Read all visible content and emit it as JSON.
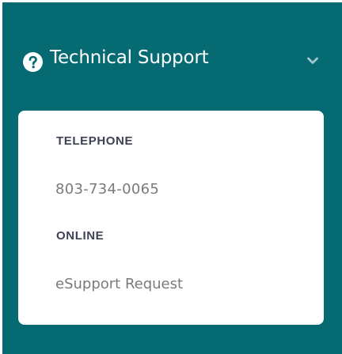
{
  "support": {
    "title": "Technical Support",
    "icons": {
      "header": "question-circle-icon",
      "toggle": "chevron-down-icon"
    },
    "colors": {
      "panel_background": "#066a73",
      "card_background": "#ffffff",
      "label_text": "#3b4252",
      "value_text": "#7a7a7a"
    },
    "telephone": {
      "label": "TELEPHONE",
      "value": "803-734-0065"
    },
    "online": {
      "label": "ONLINE",
      "link_text": "eSupport Request"
    }
  }
}
